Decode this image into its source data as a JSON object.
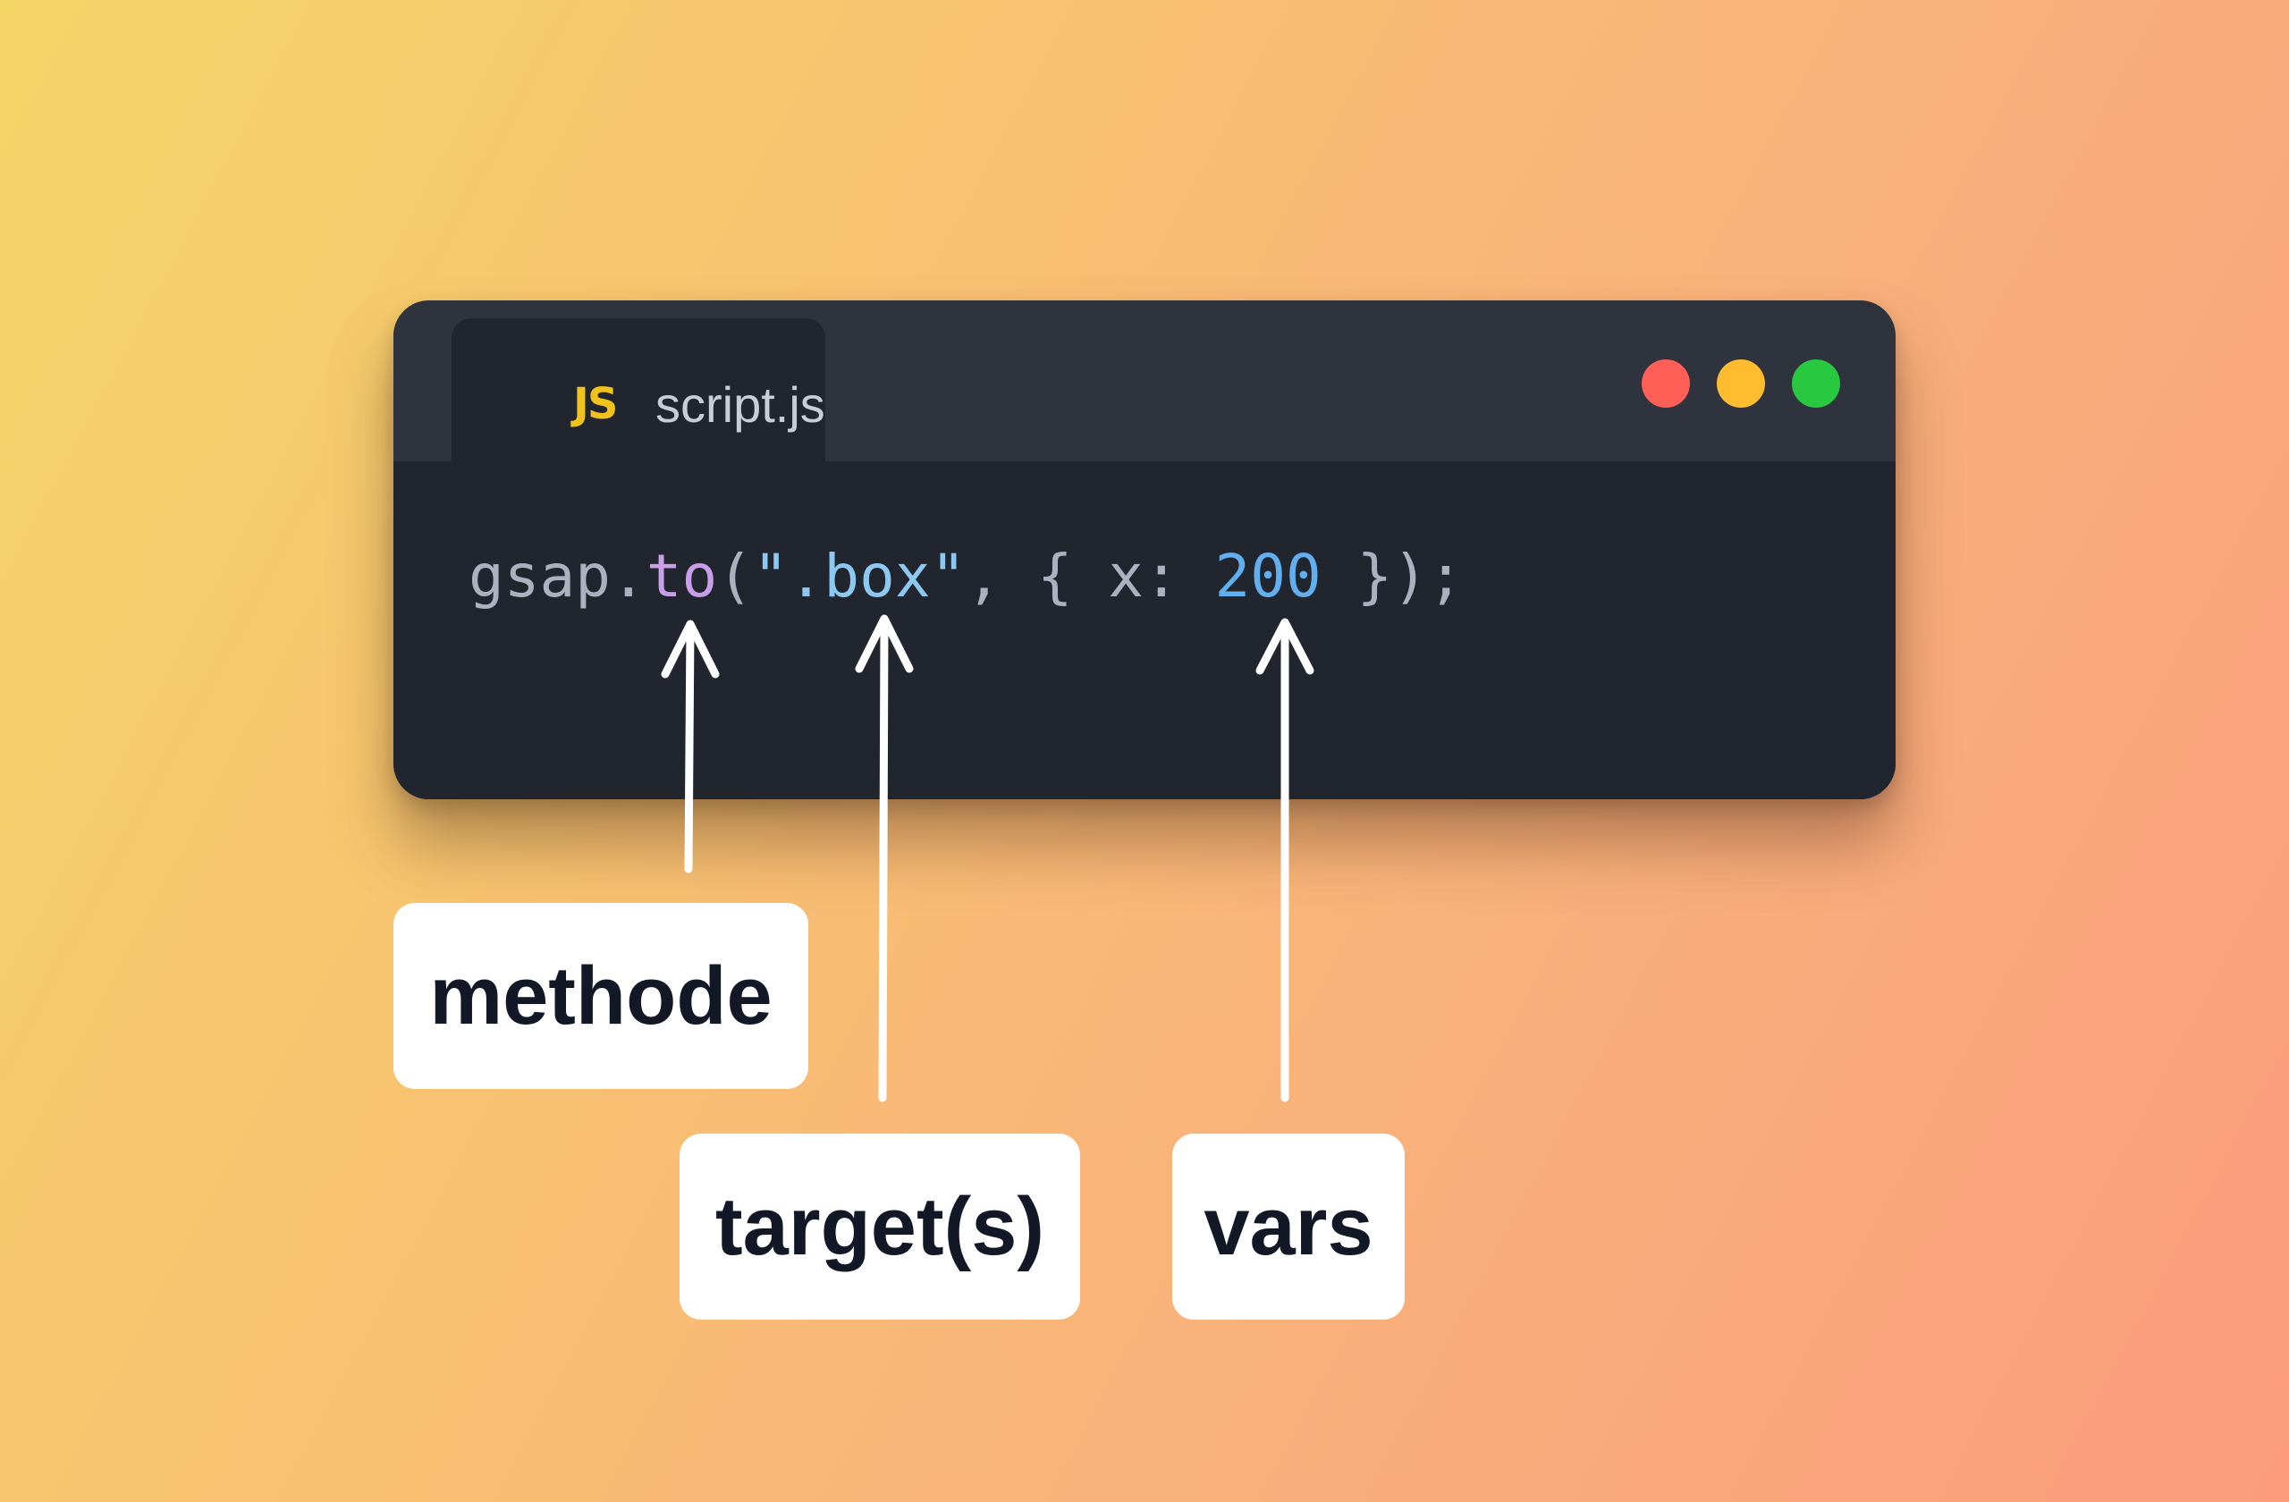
{
  "editor": {
    "tab": {
      "icon": "JS",
      "icon_name": "javascript-file-icon",
      "filename": "script.js"
    },
    "window_controls": {
      "close_color": "#ff5f57",
      "minimize_color": "#febc2e",
      "maximize_color": "#28c840"
    },
    "code": {
      "object": "gsap",
      "dot": ".",
      "method": "to",
      "open_paren": "(",
      "target": "\".box\"",
      "sep": ", { x: ",
      "value": "200",
      "close": " });"
    },
    "colors": {
      "background": "#21252e",
      "titlebar": "#2f333d",
      "method": "#c99ee8",
      "string": "#8cc8f2",
      "number": "#61afef"
    }
  },
  "annotations": {
    "method_label": "methode",
    "target_label": "target(s)",
    "vars_label": "vars"
  }
}
